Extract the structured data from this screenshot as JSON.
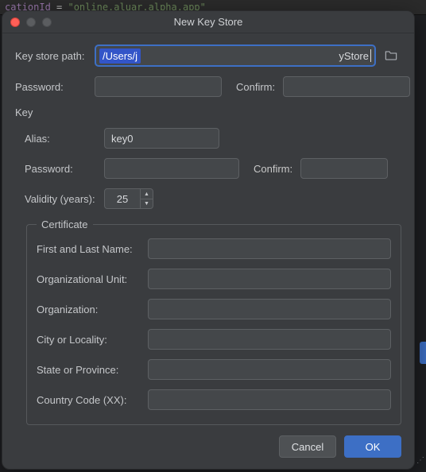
{
  "bg_code": {
    "attr": "cationId",
    "eq": " = ",
    "str": "\"online.aluar.alpha.app\""
  },
  "dialog": {
    "title": "New Key Store",
    "path_label": "Key store path:",
    "path_selected": "/Users/j",
    "path_tail": "yStore",
    "password_label": "Password:",
    "confirm_label": "Confirm:",
    "key_section": "Key",
    "alias_label": "Alias:",
    "alias_value": "key0",
    "key_password_label": "Password:",
    "key_confirm_label": "Confirm:",
    "validity_label": "Validity (years):",
    "validity_value": "25",
    "certificate_legend": "Certificate",
    "cert": {
      "first_last": "First and Last Name:",
      "ou": "Organizational Unit:",
      "org": "Organization:",
      "city": "City or Locality:",
      "state": "State or Province:",
      "cc": "Country Code (XX):"
    },
    "cancel": "Cancel",
    "ok": "OK"
  }
}
